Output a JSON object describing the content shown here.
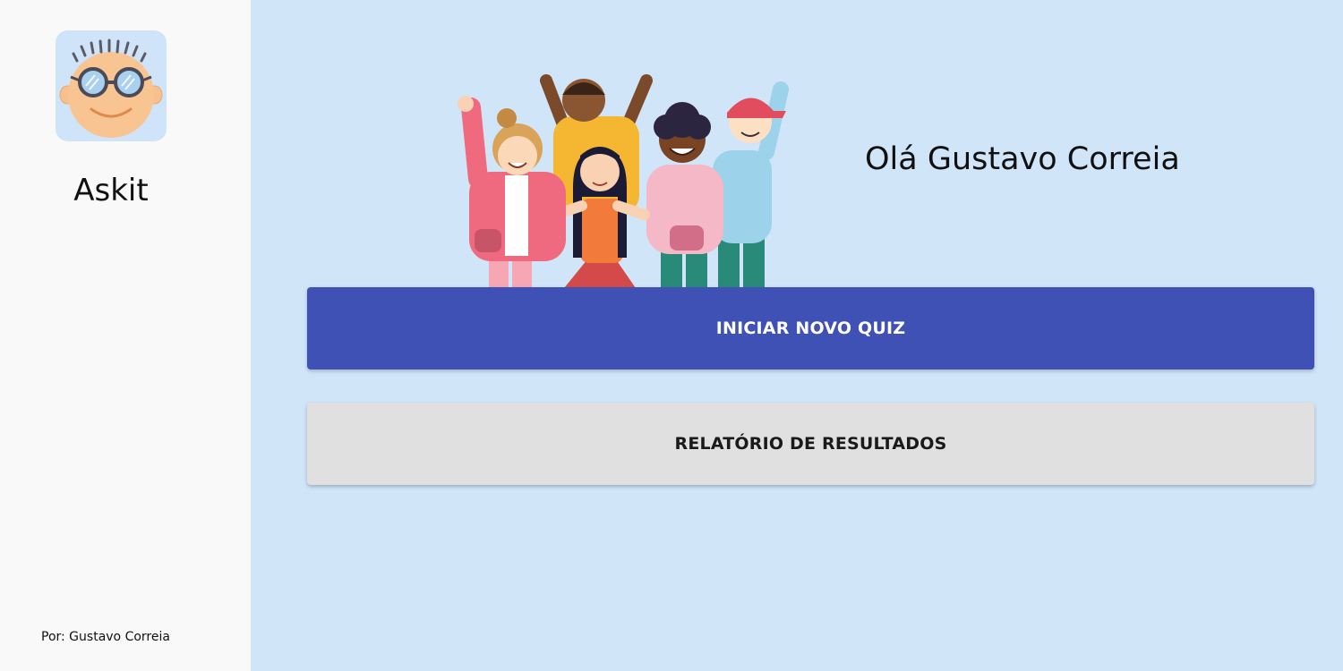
{
  "sidebar": {
    "app_name": "Askit",
    "author": "Por: Gustavo Correia",
    "logo_icon": "smiling-face-with-glasses-icon"
  },
  "main": {
    "greeting": "Olá Gustavo Correia",
    "hero_icon": "group-of-happy-kids-illustration",
    "start_quiz_label": "INICIAR NOVO QUIZ",
    "results_report_label": "RELATÓRIO DE RESULTADOS"
  },
  "colors": {
    "sidebar_bg": "#f9f9f9",
    "main_bg": "#d1e5f9",
    "primary_button": "#3f51b5",
    "secondary_button": "#e0e0e0"
  }
}
